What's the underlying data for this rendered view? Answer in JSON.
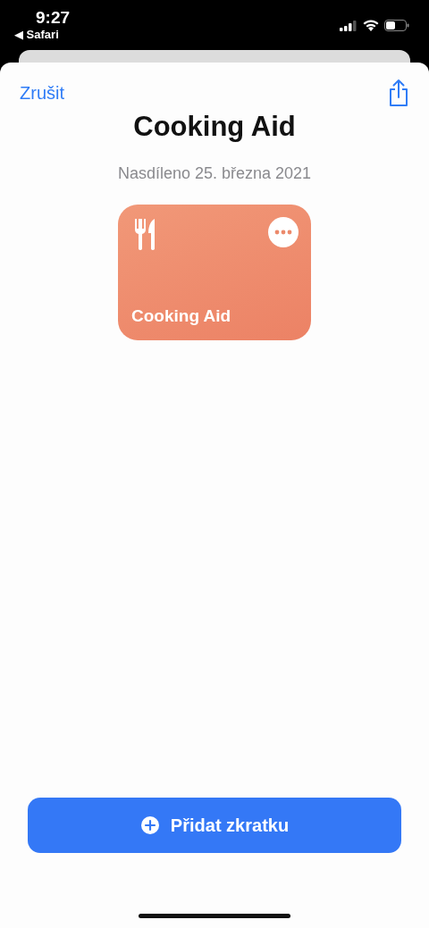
{
  "status_bar": {
    "time": "9:27",
    "back_app": "◀ Safari"
  },
  "nav": {
    "cancel": "Zrušit"
  },
  "title": "Cooking Aid",
  "subtitle": "Nasdíleno 25. března 2021",
  "shortcut_card": {
    "name": "Cooking Aid"
  },
  "add_button": {
    "label": "Přidat zkratku"
  }
}
